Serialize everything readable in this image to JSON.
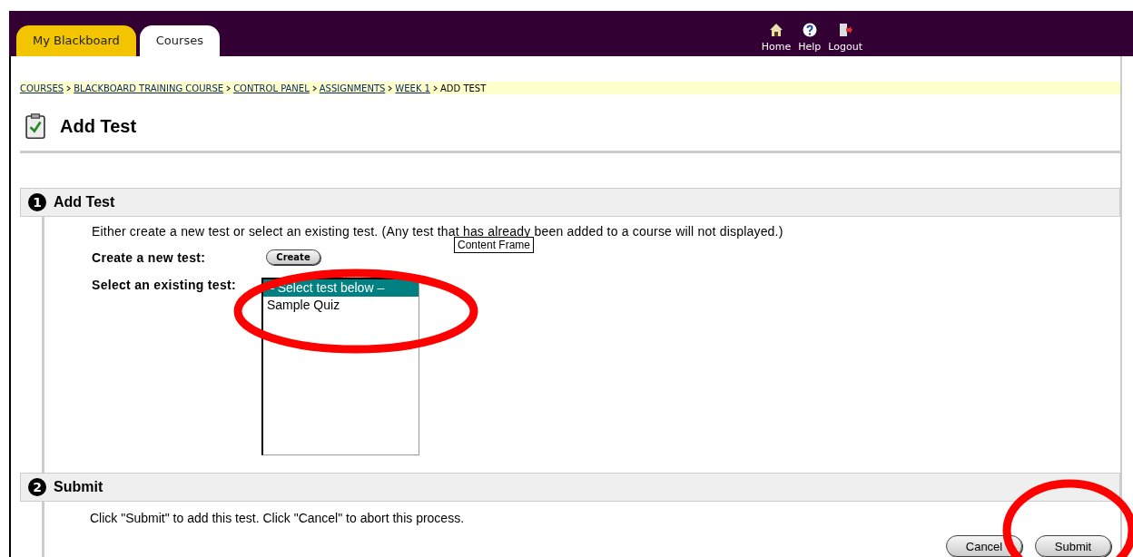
{
  "tabs": [
    {
      "label": "My Blackboard",
      "selected": false
    },
    {
      "label": "Courses",
      "selected": true
    }
  ],
  "header_links": [
    {
      "label": "Home",
      "kind": "home"
    },
    {
      "label": "Help",
      "kind": "help"
    },
    {
      "label": "Logout",
      "kind": "logout"
    }
  ],
  "breadcrumb": [
    {
      "label": "COURSES",
      "link": true
    },
    {
      "label": "BLACKBOARD TRAINING COURSE",
      "link": true
    },
    {
      "label": "CONTROL PANEL",
      "link": true
    },
    {
      "label": "ASSIGNMENTS",
      "link": true
    },
    {
      "label": "WEEK 1",
      "link": true
    },
    {
      "label": "ADD TEST",
      "link": false
    }
  ],
  "page_title": "Add Test",
  "section_1": {
    "number": "1",
    "title": "Add Test",
    "description": "Either create a new test or select an existing test. (Any test that has already been added to a course will not displayed.)",
    "create_label": "Create a new test:",
    "create_button": "Create",
    "select_label": "Select an existing test:",
    "options": [
      {
        "label": "– Select test below –",
        "selected": true
      },
      {
        "label": "Sample Quiz",
        "selected": false
      }
    ]
  },
  "tooltip": "Content Frame",
  "section_2": {
    "number": "2",
    "title": "Submit",
    "description": "Click \"Submit\" to add this test. Click \"Cancel\" to abort this process."
  },
  "buttons": [
    "Cancel",
    "Submit"
  ]
}
